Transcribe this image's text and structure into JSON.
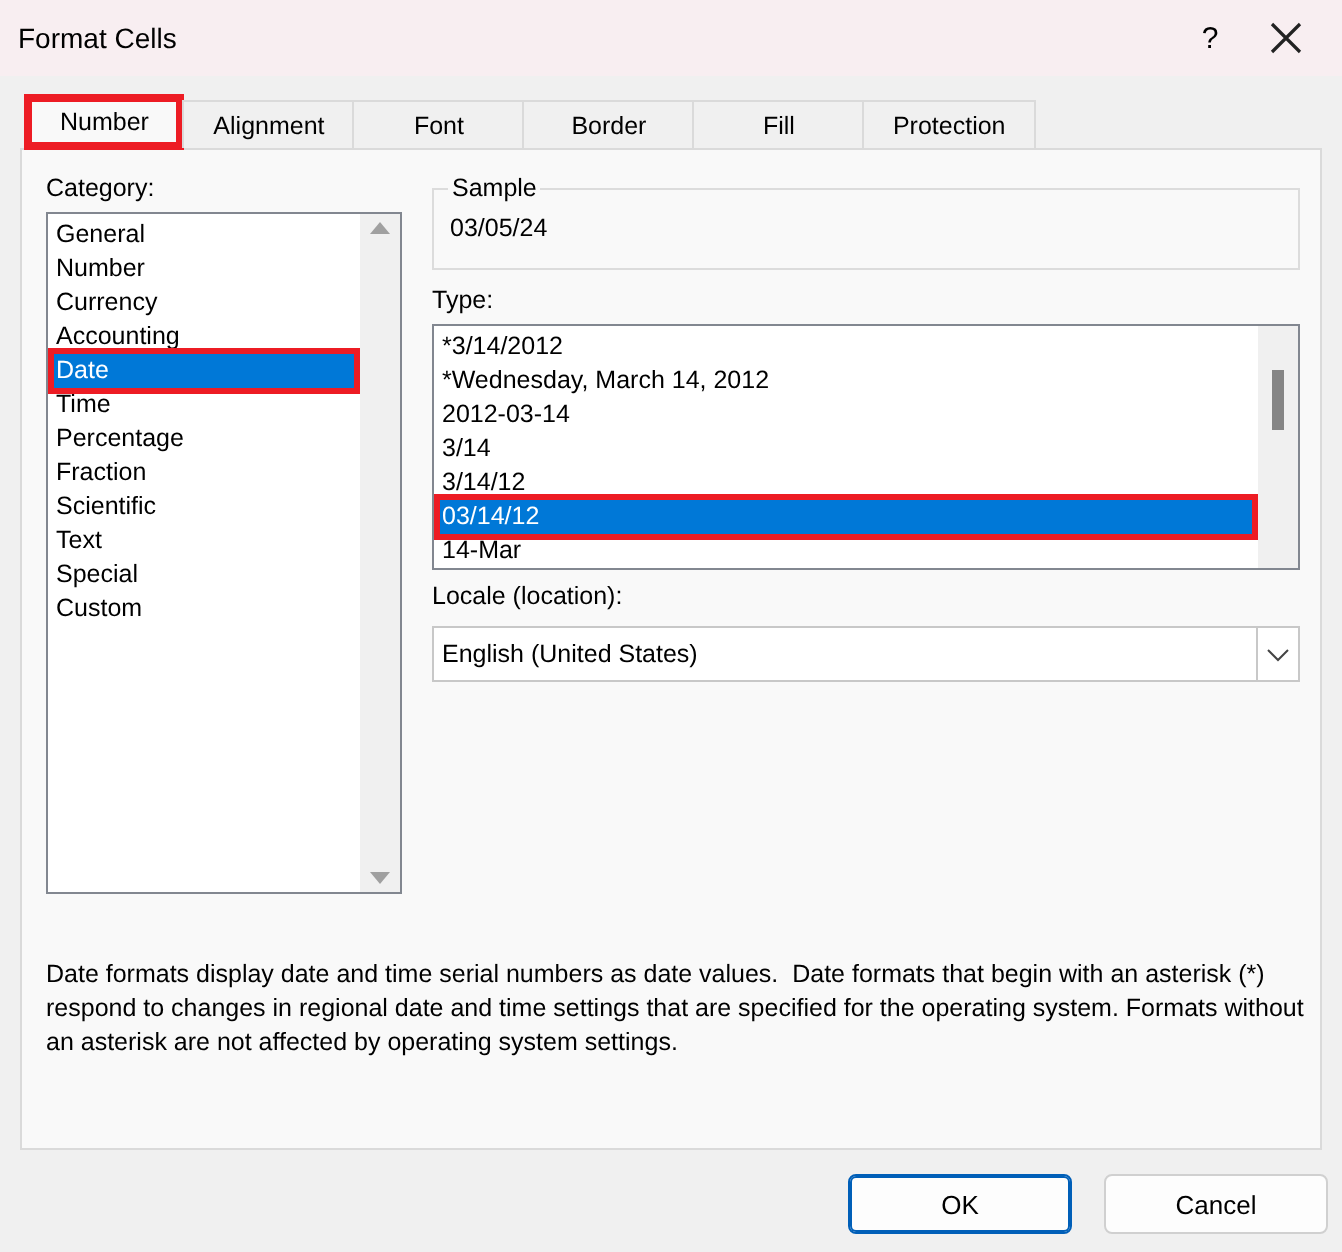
{
  "window": {
    "title": "Format Cells",
    "help_button": "?"
  },
  "tabs": [
    {
      "label": "Number",
      "selected": true,
      "highlighted": true
    },
    {
      "label": "Alignment",
      "selected": false,
      "highlighted": false
    },
    {
      "label": "Font",
      "selected": false,
      "highlighted": false
    },
    {
      "label": "Border",
      "selected": false,
      "highlighted": false
    },
    {
      "label": "Fill",
      "selected": false,
      "highlighted": false
    },
    {
      "label": "Protection",
      "selected": false,
      "highlighted": false
    }
  ],
  "category": {
    "label": "Category:",
    "items": [
      {
        "label": "General",
        "selected": false,
        "highlighted": false
      },
      {
        "label": "Number",
        "selected": false,
        "highlighted": false
      },
      {
        "label": "Currency",
        "selected": false,
        "highlighted": false
      },
      {
        "label": "Accounting",
        "selected": false,
        "highlighted": false
      },
      {
        "label": "Date",
        "selected": true,
        "highlighted": true
      },
      {
        "label": "Time",
        "selected": false,
        "highlighted": false
      },
      {
        "label": "Percentage",
        "selected": false,
        "highlighted": false
      },
      {
        "label": "Fraction",
        "selected": false,
        "highlighted": false
      },
      {
        "label": "Scientific",
        "selected": false,
        "highlighted": false
      },
      {
        "label": "Text",
        "selected": false,
        "highlighted": false
      },
      {
        "label": "Special",
        "selected": false,
        "highlighted": false
      },
      {
        "label": "Custom",
        "selected": false,
        "highlighted": false
      }
    ]
  },
  "sample": {
    "label": "Sample",
    "value": "03/05/24"
  },
  "type": {
    "label": "Type:",
    "items": [
      {
        "label": "*3/14/2012",
        "selected": false,
        "highlighted": false
      },
      {
        "label": "*Wednesday, March 14, 2012",
        "selected": false,
        "highlighted": false
      },
      {
        "label": "2012-03-14",
        "selected": false,
        "highlighted": false
      },
      {
        "label": "3/14",
        "selected": false,
        "highlighted": false
      },
      {
        "label": "3/14/12",
        "selected": false,
        "highlighted": false
      },
      {
        "label": "03/14/12",
        "selected": true,
        "highlighted": true
      },
      {
        "label": "14-Mar",
        "selected": false,
        "highlighted": false
      }
    ]
  },
  "locale": {
    "label": "Locale (location):",
    "value": "English (United States)"
  },
  "description": "Date formats display date and time serial numbers as date values.  Date formats that begin with an asterisk (*) respond to changes in regional date and time settings that are specified for the operating system. Formats without an asterisk are not affected by operating system settings.",
  "buttons": [
    {
      "label": "OK",
      "default": true
    },
    {
      "label": "Cancel",
      "default": false
    }
  ]
}
